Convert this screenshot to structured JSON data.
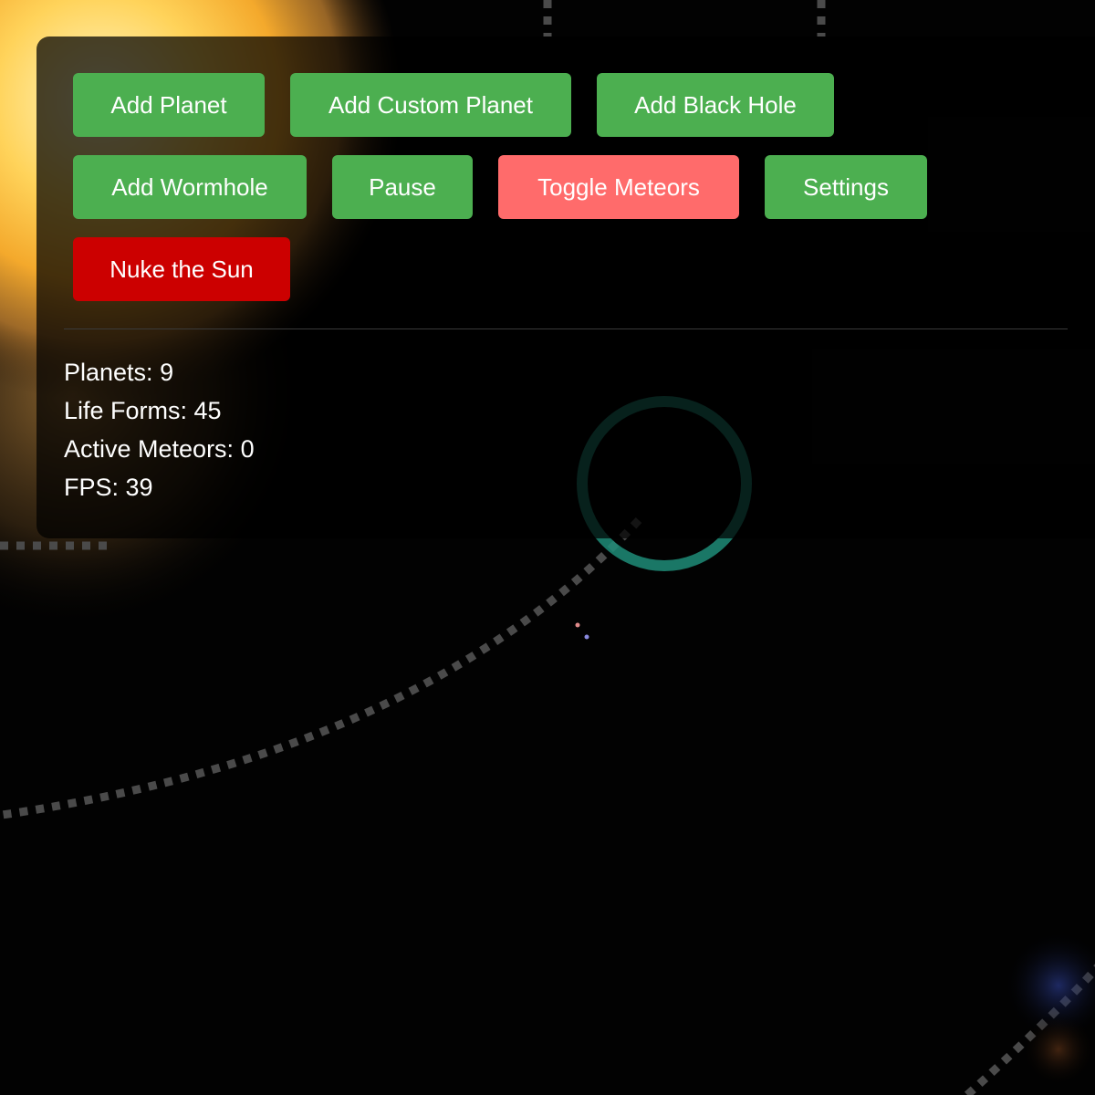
{
  "colors": {
    "background": "#000000",
    "panel": "#0a0a0a",
    "button_green": "#4caf50",
    "button_pink": "#ff6b6b",
    "button_red": "#cc0000",
    "sun": "#f4b942",
    "orbit": "#555555",
    "wormhole": "#1e8c78"
  },
  "controls": {
    "row1": {
      "add_planet": "Add Planet",
      "add_custom_planet": "Add Custom Planet",
      "add_black_hole": "Add Black Hole"
    },
    "row2": {
      "add_wormhole": "Add Wormhole",
      "pause": "Pause",
      "toggle_meteors": "Toggle Meteors",
      "settings": "Settings"
    },
    "row3": {
      "nuke_sun": "Nuke the Sun"
    }
  },
  "stats": {
    "planets_label": "Planets: ",
    "planets_value": "9",
    "life_forms_label": "Life Forms: ",
    "life_forms_value": "45",
    "meteors_label": "Active Meteors: ",
    "meteors_value": "0",
    "fps_label": "FPS: ",
    "fps_value": "39"
  },
  "scene": {
    "sun_icon": "sun",
    "wormhole_icon": "wormhole-ring",
    "orbit_style": "dashed"
  }
}
